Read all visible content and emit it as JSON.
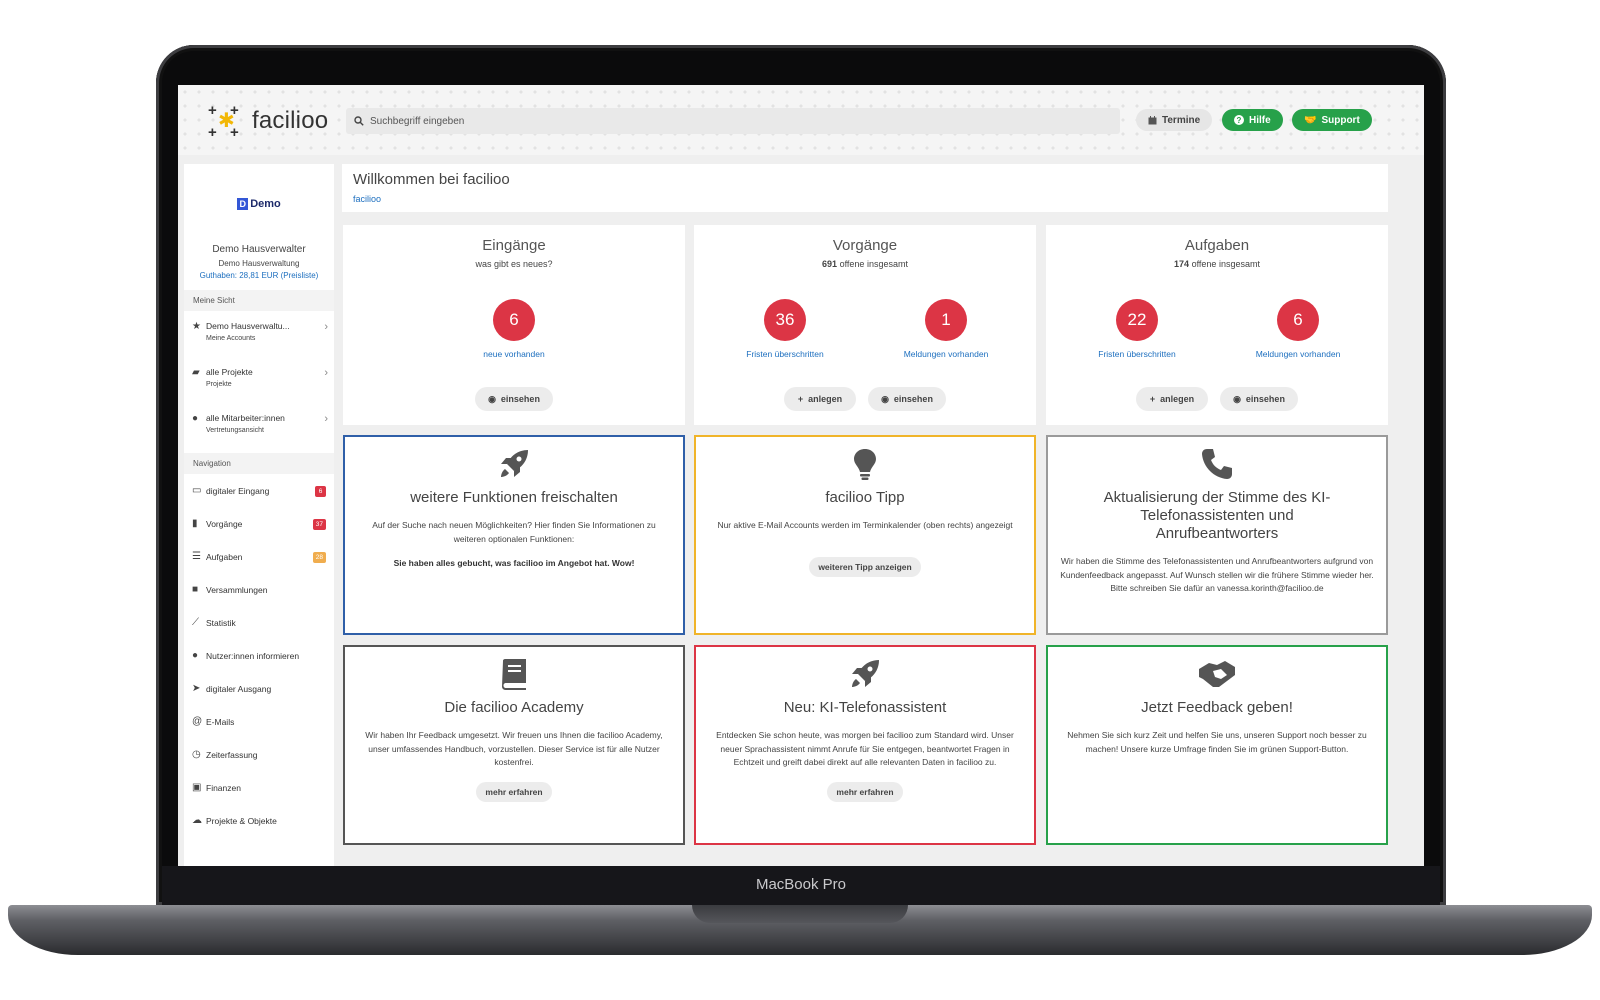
{
  "device": {
    "label": "MacBook Pro"
  },
  "header": {
    "logo_text": "facilioo",
    "search_placeholder": "Suchbegriff eingeben",
    "buttons": {
      "termine": "Termine",
      "hilfe": "Hilfe",
      "support": "Support"
    }
  },
  "sidebar": {
    "profile": {
      "logo_text": "Demo",
      "name": "Demo Hausverwalter",
      "company": "Demo Hausverwaltung",
      "credit": "Guthaben: 28,81 EUR (Preisliste)"
    },
    "meine_sicht_label": "Meine Sicht",
    "accounts": [
      {
        "label": "Demo Hausverwaltu...",
        "sub": "Meine Accounts"
      },
      {
        "label": "alle Projekte",
        "sub": "Projekte"
      },
      {
        "label": "alle Mitarbeiter:innen",
        "sub": "Vertretungsansicht"
      }
    ],
    "navigation_label": "Navigation",
    "nav": [
      {
        "label": "digitaler Eingang",
        "badge": "6"
      },
      {
        "label": "Vorgänge",
        "badge": "37"
      },
      {
        "label": "Aufgaben",
        "badge": "28"
      },
      {
        "label": "Versammlungen"
      },
      {
        "label": "Statistik"
      },
      {
        "label": "Nutzer:innen informieren"
      },
      {
        "label": "digitaler Ausgang"
      },
      {
        "label": "E-Mails"
      },
      {
        "label": "Zeiterfassung"
      },
      {
        "label": "Finanzen"
      },
      {
        "label": "Projekte & Objekte"
      }
    ],
    "colors": {
      "badge_red": "#dc3545",
      "badge_orange": "#f0ad4e"
    }
  },
  "welcome": {
    "title": "Willkommen bei facilioo",
    "breadcrumb": "facilioo"
  },
  "stats": {
    "eingaenge": {
      "title": "Eingänge",
      "subtitle": "was gibt es neues?",
      "count": "6",
      "count_label": "neue vorhanden",
      "view_button": "einsehen"
    },
    "vorgaenge": {
      "title": "Vorgänge",
      "open_count": "691",
      "open_label": "offene insgesamt",
      "overdue": "36",
      "overdue_label": "Fristen überschritten",
      "reports": "1",
      "reports_label": "Meldungen vorhanden",
      "create_button": "anlegen",
      "view_button": "einsehen"
    },
    "aufgaben": {
      "title": "Aufgaben",
      "open_count": "174",
      "open_label": "offene insgesamt",
      "overdue": "22",
      "overdue_label": "Fristen überschritten",
      "reports": "6",
      "reports_label": "Meldungen vorhanden",
      "create_button": "anlegen",
      "view_button": "einsehen"
    }
  },
  "cards": {
    "funktionen": {
      "title": "weitere Funktionen freischalten",
      "text": "Auf der Suche nach neuen Möglichkeiten? Hier finden Sie Informationen zu weiteren optionalen Funktionen:",
      "bold": "Sie haben alles gebucht, was facilioo im Angebot hat. Wow!",
      "border": "#2f5fa8",
      "icon": "rocket-icon"
    },
    "tipp": {
      "title": "facilioo Tipp",
      "text": "Nur aktive E-Mail Accounts werden im Terminkalender (oben rechts) angezeigt",
      "button": "weiteren Tipp anzeigen",
      "border": "#f0b429",
      "icon": "lightbulb-icon"
    },
    "stimme": {
      "title": "Aktualisierung der Stimme des KI-Telefonassistenten und Anrufbeantworters",
      "text": "Wir haben die Stimme des Telefonassistenten und Anrufbeantworters aufgrund von Kundenfeedback angepasst. Auf Wunsch stellen wir die frühere Stimme wieder her. Bitte schreiben Sie dafür an vanessa.korinth@facilioo.de",
      "border": "#9a9a9a",
      "icon": "phone-icon"
    },
    "academy": {
      "title": "Die facilioo Academy",
      "text": "Wir haben Ihr Feedback umgesetzt. Wir freuen uns Ihnen die facilioo Academy, unser umfassendes Handbuch, vorzustellen. Dieser Service ist für alle Nutzer kostenfrei.",
      "button": "mehr erfahren",
      "border": "#555555",
      "icon": "book-icon"
    },
    "ki": {
      "title": "Neu: KI-Telefonassistent",
      "text": "Entdecken Sie schon heute, was morgen bei facilioo zum Standard wird. Unser neuer Sprachassistent nimmt Anrufe für Sie entgegen, beantwortet Fragen in Echtzeit und greift dabei direkt auf alle relevanten Daten in facilioo zu.",
      "button": "mehr erfahren",
      "border": "#dc3545",
      "icon": "rocket-icon"
    },
    "feedback": {
      "title": "Jetzt Feedback geben!",
      "text": "Nehmen Sie sich kurz Zeit und helfen Sie uns, unseren Support noch besser zu machen! Unsere kurze Umfrage finden Sie im grünen Support-Button.",
      "border": "#27a14a",
      "icon": "handshake-icon"
    }
  }
}
